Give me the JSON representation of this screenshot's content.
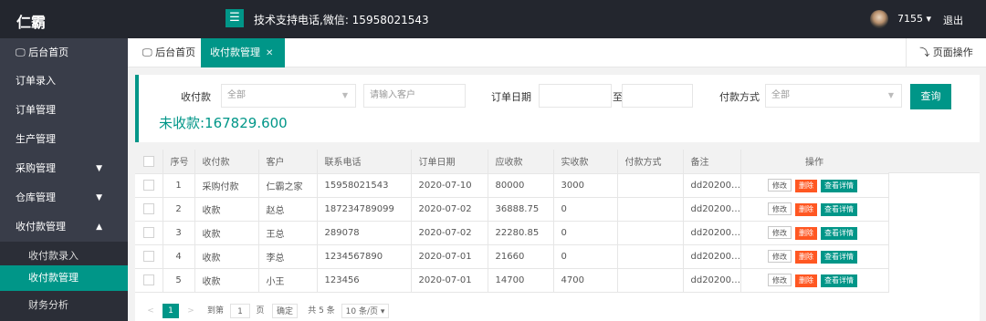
{
  "header": {
    "brand": "仁霸",
    "menu_icon": "menu-icon",
    "support": "技术支持电话,微信: 15958021543",
    "user": "7155 ▾",
    "logout": "退出"
  },
  "sidebar": {
    "items": [
      {
        "label": "🖵 后台首页"
      },
      {
        "label": "订单录入"
      },
      {
        "label": "订单管理"
      },
      {
        "label": "生产管理"
      },
      {
        "label": "采购管理"
      },
      {
        "label": "仓库管理"
      },
      {
        "label": "收付款管理"
      },
      {
        "label": "收付款录入"
      },
      {
        "label": "收付款管理"
      },
      {
        "label": "财务分析"
      }
    ]
  },
  "tabs": {
    "home": "🖵 后台首页",
    "current": "收付款管理",
    "page_ops": "⤵ 页面操作"
  },
  "filter": {
    "type_label": "收付款",
    "type_value": "全部",
    "customer_placeholder": "请输入客户",
    "date_label": "订单日期",
    "date_to": "至",
    "pay_label": "付款方式",
    "pay_value": "全部",
    "search": "查询",
    "unpaid": "未收款:167829.600"
  },
  "table": {
    "headers": [
      "序号",
      "收付款",
      "客户",
      "联系电话",
      "订单日期",
      "应收款",
      "实收款",
      "付款方式",
      "备注",
      "操作"
    ],
    "rows": [
      {
        "no": "1",
        "type": "采购付款",
        "customer": "仁霸之家",
        "phone": "15958021543",
        "date": "2020-07-10",
        "due": "80000",
        "paid": "3000",
        "method": "",
        "note": "dd20200…"
      },
      {
        "no": "2",
        "type": "收款",
        "customer": "赵总",
        "phone": "187234789099",
        "date": "2020-07-02",
        "due": "36888.75",
        "paid": "0",
        "method": "",
        "note": "dd20200…"
      },
      {
        "no": "3",
        "type": "收款",
        "customer": "王总",
        "phone": "289078",
        "date": "2020-07-02",
        "due": "22280.85",
        "paid": "0",
        "method": "",
        "note": "dd20200…"
      },
      {
        "no": "4",
        "type": "收款",
        "customer": "李总",
        "phone": "1234567890",
        "date": "2020-07-01",
        "due": "21660",
        "paid": "0",
        "method": "",
        "note": "dd20200…"
      },
      {
        "no": "5",
        "type": "收款",
        "customer": "小王",
        "phone": "123456",
        "date": "2020-07-01",
        "due": "14700",
        "paid": "4700",
        "method": "",
        "note": "dd20200…"
      }
    ],
    "actions": {
      "edit": "修改",
      "delete": "删除",
      "view": "查看详情"
    }
  },
  "pager": {
    "prev": "<",
    "current": "1",
    "next": ">",
    "goto": "到第",
    "page_input": "1",
    "page_unit": "页",
    "confirm": "确定",
    "total": "共 5 条",
    "page_size": "10 条/页 ▾"
  },
  "colors": {
    "accent": "#009688",
    "danger": "#ff5722",
    "sidebar": "#393d49",
    "topbar": "#23262e"
  }
}
